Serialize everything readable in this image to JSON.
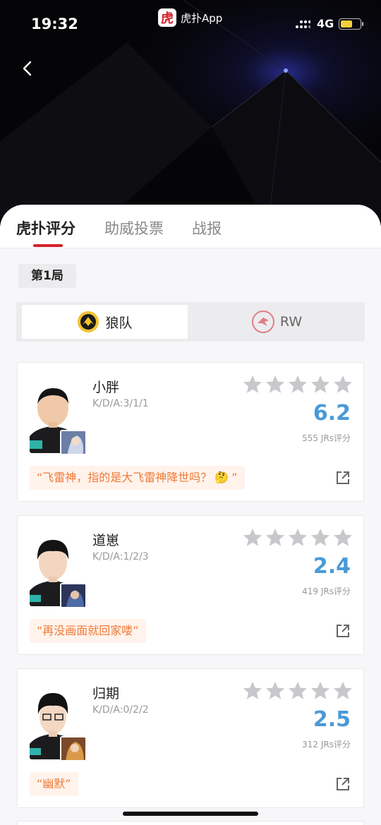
{
  "status": {
    "time": "19:32",
    "app_name": "虎扑App",
    "app_logo_glyph": "虎",
    "network": "4G",
    "battery_level": 0.6
  },
  "tabs": [
    {
      "label": "虎扑评分",
      "active": true
    },
    {
      "label": "助威投票",
      "active": false
    },
    {
      "label": "战报",
      "active": false
    }
  ],
  "round": {
    "label": "第1局"
  },
  "teams": [
    {
      "name": "狼队",
      "active": true
    },
    {
      "name": "RW",
      "active": false
    }
  ],
  "players": [
    {
      "name": "小胖",
      "kda": "K/D/A:3/1/1",
      "score": "6.2",
      "count": "555 JRs评分",
      "quote": "“飞雷神，指的是大飞雷神降世吗？",
      "quote_end": "”",
      "quote_emoji": "🤔",
      "stars": 0
    },
    {
      "name": "道崽",
      "kda": "K/D/A:1/2/3",
      "score": "2.4",
      "count": "419 JRs评分",
      "quote": "“再没画面就回家喽”",
      "quote_end": "",
      "quote_emoji": "",
      "stars": 0
    },
    {
      "name": "归期",
      "kda": "K/D/A:0/2/2",
      "score": "2.5",
      "count": "312 JRs评分",
      "quote": "“幽默”",
      "quote_end": "",
      "quote_emoji": "",
      "stars": 0
    }
  ],
  "colors": {
    "accent": "#d6202a",
    "score": "#4a9ad8",
    "quote_text": "#f07a36",
    "quote_bg": "#fff3ec",
    "star": "#c8c8cc"
  },
  "icons": {
    "back": "chevron-left-icon",
    "share": "share-icon",
    "star": "star-icon"
  }
}
